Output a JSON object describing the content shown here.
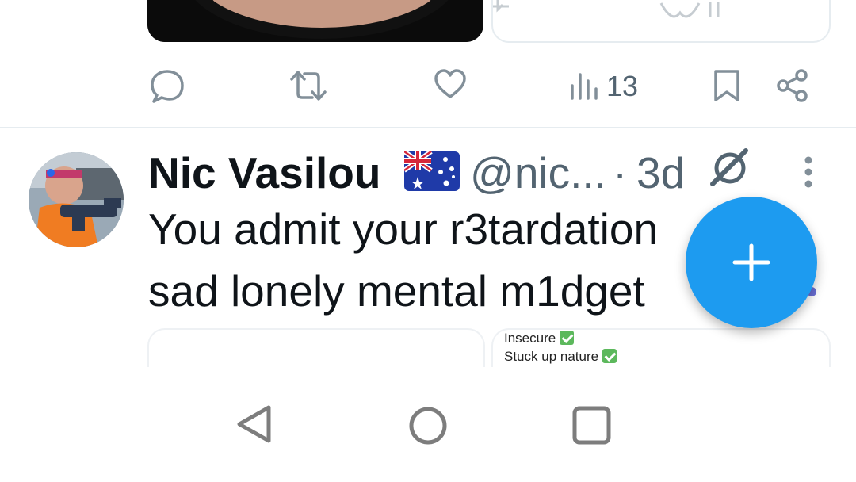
{
  "previous_tweet": {
    "actions": {
      "reply": {
        "icon": "reply-icon"
      },
      "retweet": {
        "icon": "retweet-icon"
      },
      "like": {
        "icon": "heart-icon"
      },
      "views": {
        "icon": "bar-chart-icon",
        "count": "13"
      },
      "bookmark": {
        "icon": "bookmark-icon"
      },
      "share": {
        "icon": "share-icon"
      }
    }
  },
  "tweet": {
    "author_name": "Nic Vasilou",
    "flag": "australia-flag",
    "handle": "@nic...",
    "separator": "·",
    "time": "3d",
    "text_line1": "You admit your r3tardation",
    "text_line2": "sad lonely mental m1dget",
    "card_lines": [
      "Insecure",
      "Stuck up nature"
    ]
  },
  "fab": {
    "icon": "plus-icon",
    "color": "#1d9bf0"
  },
  "system_nav": {
    "back": "back-triangle-icon",
    "home": "home-circle-icon",
    "recents": "recents-square-icon"
  }
}
